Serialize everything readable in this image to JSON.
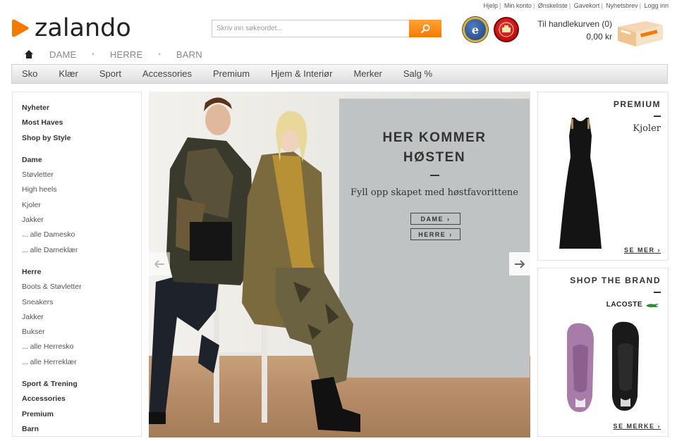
{
  "topbar": {
    "links": [
      "Hjelp",
      "Min konto",
      "Ønskeliste",
      "Gavekort",
      "Nyhetsbrev",
      "Logg inn"
    ]
  },
  "logo": {
    "text": "zalando"
  },
  "search": {
    "placeholder": "Skriv inn søkeordet...",
    "value": ""
  },
  "badges": {
    "ekomi_letter": "e"
  },
  "cart": {
    "label": "Til handlekurven (0)",
    "amount": "0,00 kr"
  },
  "gender_nav": {
    "items": [
      "DAME",
      "HERRE",
      "BARN"
    ]
  },
  "categories": [
    "Sko",
    "Klær",
    "Sport",
    "Accessories",
    "Premium",
    "Hjem & Interiør",
    "Merker",
    "Salg %"
  ],
  "sidebar": {
    "top": [
      "Nyheter",
      "Most Haves",
      "Shop by Style"
    ],
    "dame": [
      "Dame",
      "Støvletter",
      "High heels",
      "Kjoler",
      "Jakker",
      "... alle Damesko",
      "... alle Dameklær"
    ],
    "herre": [
      "Herre",
      "Boots & Støvletter",
      "Sneakers",
      "Jakker",
      "Bukser",
      "... alle Herresko",
      "... alle Herreklær"
    ],
    "bottom": [
      "Sport & Trening",
      "Accessories",
      "Premium",
      "Barn"
    ]
  },
  "hero": {
    "title_line1": "HER KOMMER",
    "title_line2": "HØSTEN",
    "subtitle": "Fyll opp skapet med høstfavorittene",
    "btn_dame": "DAME",
    "btn_herre": "HERRE"
  },
  "premium_tile": {
    "title": "PREMIUM",
    "subtitle": "Kjoler",
    "link": "SE MER"
  },
  "brand_tile": {
    "title": "SHOP THE BRAND",
    "brand": "LACOSTE",
    "link": "SE MERKE"
  },
  "colors": {
    "accent_orange": "#f47a00",
    "text_dark": "#333333",
    "panel_grey": "#bfc3c3"
  }
}
